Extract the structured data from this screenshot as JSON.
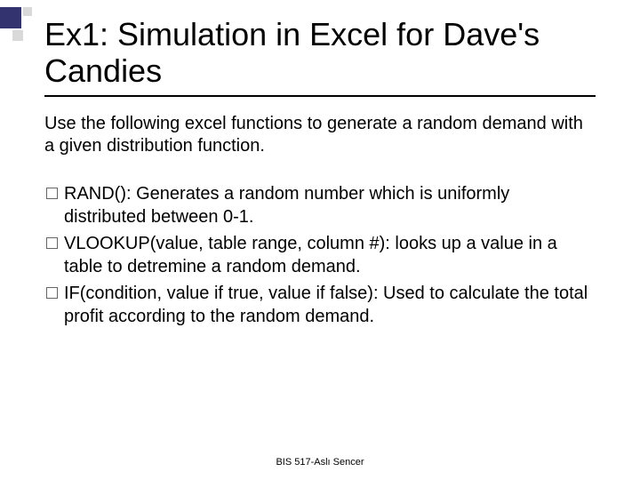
{
  "title": "Ex1: Simulation in Excel for Dave's Candies",
  "intro": "Use the following excel functions to generate a random demand with a given distribution function.",
  "bullets": [
    "RAND(): Generates a random number which is uniformly distributed between 0-1.",
    "VLOOKUP(value, table range, column #): looks up a value in a table to detremine a random demand.",
    "IF(condition, value if true, value if false): Used to calculate the total profit according to the random demand."
  ],
  "footer": "BIS 517-Aslı Sencer"
}
